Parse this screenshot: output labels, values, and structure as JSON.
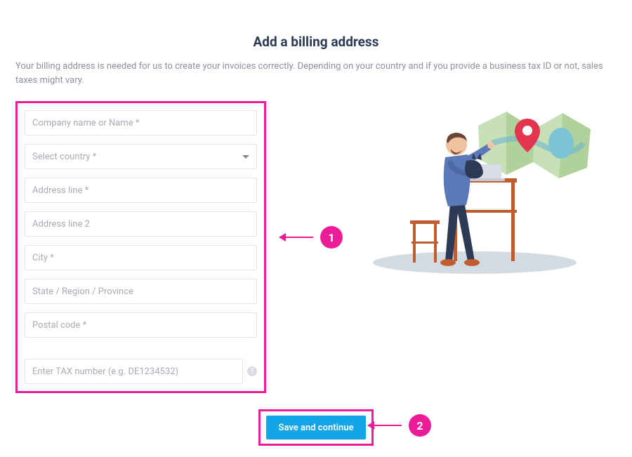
{
  "header": {
    "title": "Add a billing address",
    "description": "Your billing address is needed for us to create your invoices correctly. Depending on your country and if you provide a business tax ID or not, sales taxes might vary."
  },
  "form": {
    "company_placeholder": "Company name or Name *",
    "country_placeholder": "Select country *",
    "address1_placeholder": "Address line *",
    "address2_placeholder": "Address line 2",
    "city_placeholder": "City *",
    "state_placeholder": "State / Region / Province",
    "postal_placeholder": "Postal code *",
    "tax_placeholder": "Enter TAX number (e.g. DE1234532)"
  },
  "buttons": {
    "save": "Save and continue"
  },
  "annotations": {
    "one": "1",
    "two": "2"
  },
  "colors": {
    "annotation": "#ec1c99",
    "primary_button": "#14a5e8"
  }
}
